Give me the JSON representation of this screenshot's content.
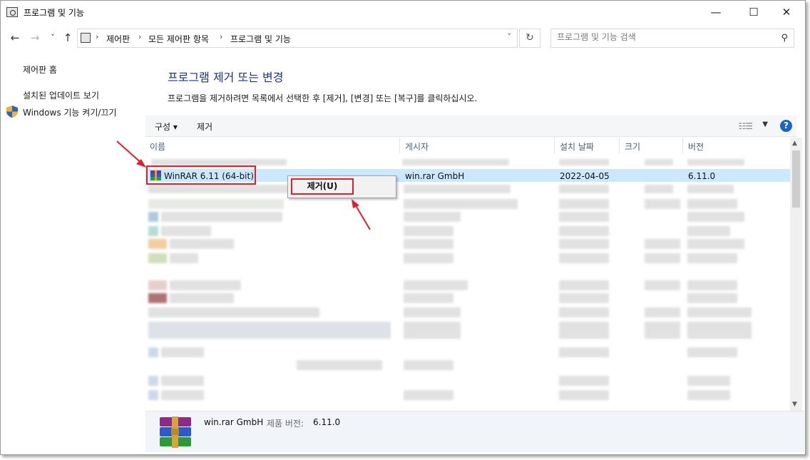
{
  "window": {
    "title": "프로그램 및 기능",
    "minimize_glyph": "—",
    "maximize_glyph": "☐",
    "close_glyph": "✕"
  },
  "nav": {
    "back": "←",
    "forward": "→",
    "recent": "˅",
    "up": "↑",
    "refresh": "↻"
  },
  "breadcrumb": [
    "제어판",
    "모든 제어판 항목",
    "프로그램 및 기능"
  ],
  "search": {
    "placeholder": "프로그램 및 기능 검색"
  },
  "sidebar": {
    "items": [
      {
        "label": "제어판 홈"
      },
      {
        "label": "설치된 업데이트 보기"
      },
      {
        "label": "Windows 기능 켜기/끄기"
      }
    ]
  },
  "main": {
    "title": "프로그램 제거 또는 변경",
    "description": "프로그램을 제거하려면 목록에서 선택한 후 [제거], [변경] 또는 [복구]를 클릭하십시오."
  },
  "toolbar": {
    "organize_label": "구성",
    "uninstall_label": "제거",
    "help_glyph": "?"
  },
  "columns": [
    "이름",
    "게시자",
    "설치 날짜",
    "크기",
    "버전"
  ],
  "selected_row": {
    "name": "WinRAR 6.11 (64-bit)",
    "publisher": "win.rar GmbH",
    "installed": "2022-04-05",
    "size": "",
    "version": "6.11.0"
  },
  "context_menu": {
    "uninstall_label": "제거(U)"
  },
  "details": {
    "publisher": "win.rar GmbH",
    "version_label": "제품 버전:",
    "version": "6.11.0"
  },
  "colors": {
    "accent_title": "#1e3287",
    "selection": "#cce8ff",
    "highlight_red": "#e0202a",
    "help_blue": "#1a65c6"
  }
}
